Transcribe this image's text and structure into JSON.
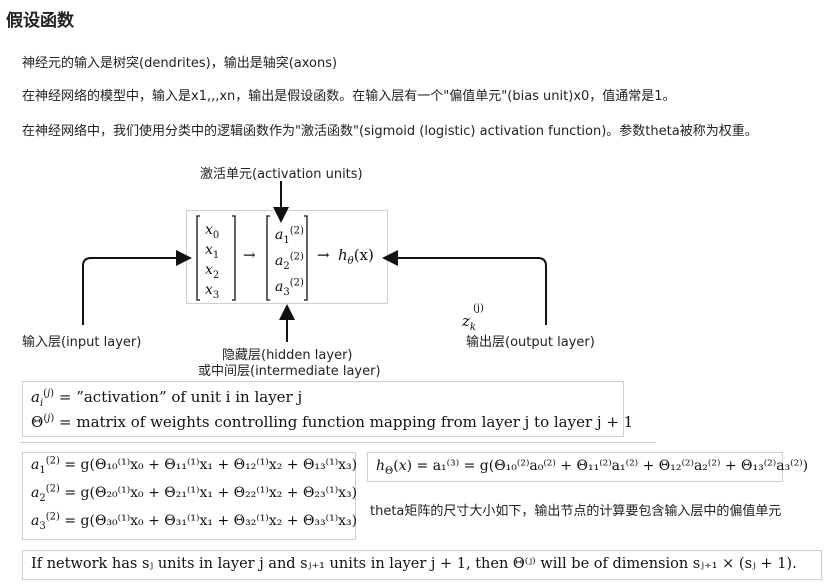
{
  "page": {
    "title": "假设函数",
    "para1": "神经元的输入是树突(dendrites)，输出是轴突(axons)",
    "para2": "在神经网络的模型中，输入是x1,,,xn，输出是假设函数。在输入层有一个\"偏值单元\"(bias unit)x0，值通常是1。",
    "para3": "在神经网络中，我们使用分类中的逻辑函数作为\"激活函数\"(sigmoid (logistic) activation function)。参数theta被称为权重。"
  },
  "diagram": {
    "activation_label": "激活单元(activation units)",
    "input_label": "输入层(input layer)",
    "hidden_label_1": "隐藏层(hidden layer)",
    "hidden_label_2": "或中间层(intermediate layer)",
    "output_label": "输出层(output layer)",
    "z_label": "z",
    "z_sub": "k",
    "z_sup": "(j)",
    "input_vector": [
      "x",
      "x",
      "x",
      "x"
    ],
    "input_subs": [
      "0",
      "1",
      "2",
      "3"
    ],
    "hidden_vector": [
      "a",
      "a",
      "a"
    ],
    "hidden_subs": [
      "1",
      "2",
      "3"
    ],
    "hidden_sup": "(2)",
    "arrow": "→",
    "output_expr": "h",
    "output_sub": "θ",
    "output_arg": "(x)"
  },
  "definitions": {
    "line1_text": "= ”activation” of unit i in layer j",
    "line2_text": "= matrix of weights controlling function mapping from layer j to layer j + 1"
  },
  "equations": {
    "a1": "= g(Θ₁₀⁽¹⁾x₀ + Θ₁₁⁽¹⁾x₁ + Θ₁₂⁽¹⁾x₂ + Θ₁₃⁽¹⁾x₃)",
    "a2": "= g(Θ₂₀⁽¹⁾x₀ + Θ₂₁⁽¹⁾x₁ + Θ₂₂⁽¹⁾x₂ + Θ₂₃⁽¹⁾x₃)",
    "a3": "= g(Θ₃₀⁽¹⁾x₀ + Θ₃₁⁽¹⁾x₁ + Θ₃₂⁽¹⁾x₂ + Θ₃₃⁽¹⁾x₃)",
    "h": "= a₁⁽³⁾ = g(Θ₁₀⁽²⁾a₀⁽²⁾ + Θ₁₁⁽²⁾a₁⁽²⁾ + Θ₁₂⁽²⁾a₂⁽²⁾ + Θ₁₃⁽²⁾a₃⁽²⁾)",
    "note": "theta矩阵的尺寸大小如下，输出节点的计算要包含输入层中的偏值单元"
  },
  "dimension": {
    "text": "If network has sⱼ units in layer j and sⱼ₊₁ units in layer j + 1, then Θ⁽ʲ⁾ will be of dimension sⱼ₊₁ × (sⱼ + 1)."
  }
}
